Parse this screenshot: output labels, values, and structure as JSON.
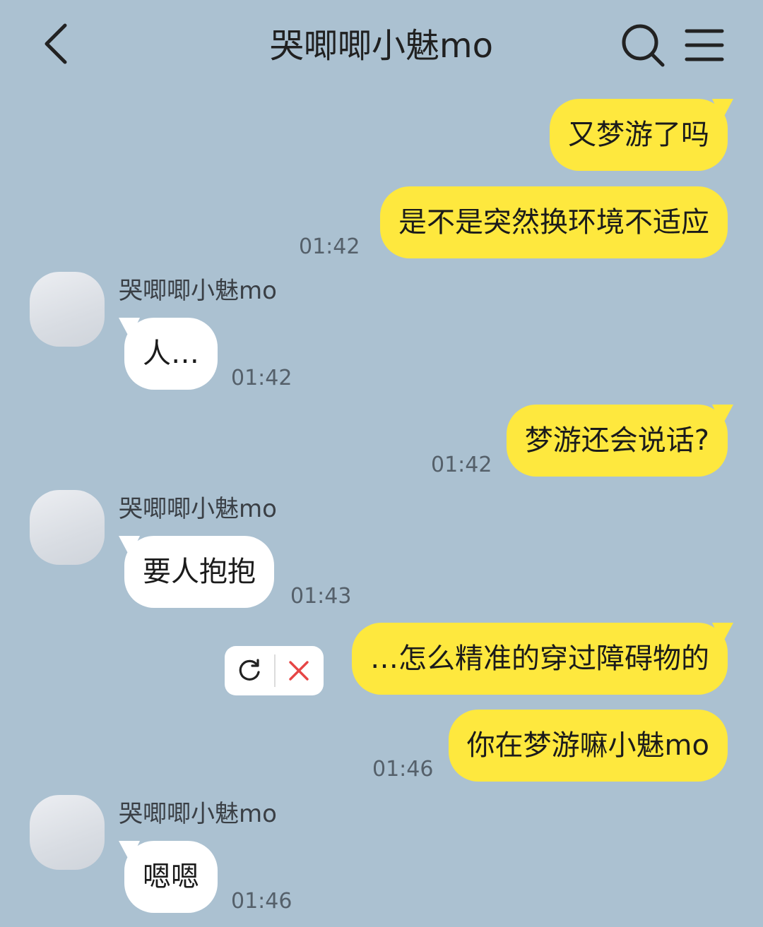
{
  "header": {
    "title": "哭唧唧小魅mo",
    "back_icon": "chevron-left-icon",
    "search_icon": "search-icon",
    "menu_icon": "menu-icon"
  },
  "colors": {
    "background": "#abc1d1",
    "outgoing_bubble": "#fee83e",
    "incoming_bubble": "#ffffff",
    "delete_red": "#e64545"
  },
  "messages": [
    {
      "direction": "out",
      "text": "又梦游了吗",
      "time": ""
    },
    {
      "direction": "out",
      "text": "是不是突然换环境不适应",
      "time": "01:42"
    },
    {
      "direction": "in",
      "sender": "哭唧唧小魅mo",
      "text": "人…",
      "time": "01:42"
    },
    {
      "direction": "out",
      "text": "梦游还会说话?",
      "time": "01:42"
    },
    {
      "direction": "in",
      "sender": "哭唧唧小魅mo",
      "text": "要人抱抱",
      "time": "01:43"
    },
    {
      "direction": "out",
      "text": "…怎么精准的穿过障碍物的",
      "time": "",
      "failed": true
    },
    {
      "direction": "out",
      "text": "你在梦游嘛小魅mo",
      "time": "01:46"
    },
    {
      "direction": "in",
      "sender": "哭唧唧小魅mo",
      "text": "嗯嗯",
      "time": "01:46"
    }
  ],
  "fail_actions": {
    "resend_icon": "refresh-icon",
    "delete_icon": "close-icon"
  }
}
